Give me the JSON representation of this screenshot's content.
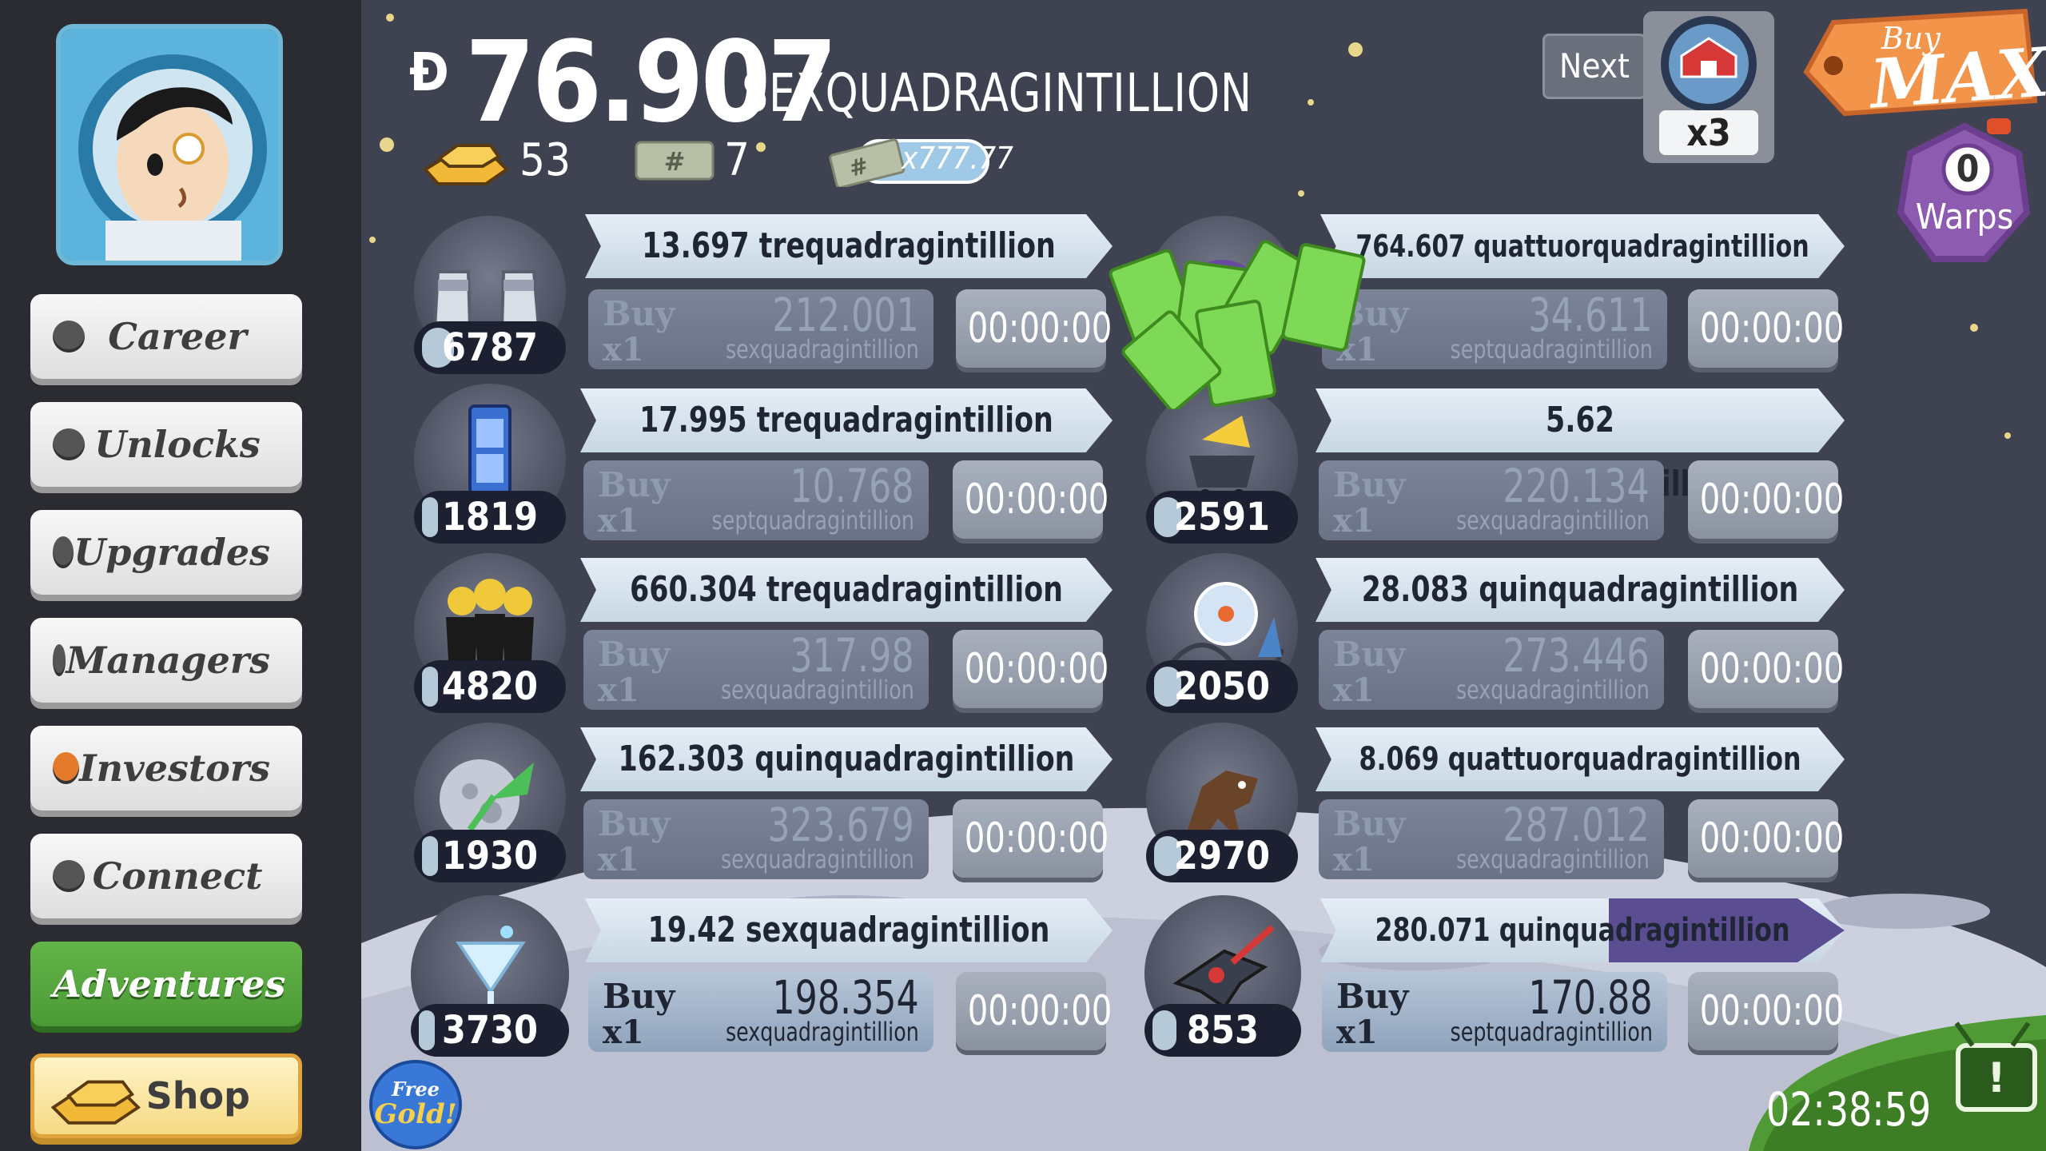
{
  "money": {
    "symbol": "Đ",
    "value": "76.907",
    "unit": "SEXQUADRAGINTILLION"
  },
  "stats": {
    "gold": "53",
    "megabucks": "7",
    "multiplier": "x777.77"
  },
  "nav": [
    {
      "label": "Career",
      "dot": "#555555"
    },
    {
      "label": "Unlocks",
      "dot": "#555555"
    },
    {
      "label": "Upgrades",
      "dot": "#555555"
    },
    {
      "label": "Managers",
      "dot": "#555555"
    },
    {
      "label": "Investors",
      "dot": "#e57a2a"
    },
    {
      "label": "Connect",
      "dot": "#555555"
    },
    {
      "label": "Adventures",
      "dot": "#555555"
    },
    {
      "label": "Shop"
    }
  ],
  "top_right": {
    "next_label": "Next",
    "next_multiplier": "x3",
    "buy_label": "Buy",
    "max_label": "MAX",
    "warps_count": "0",
    "warps_label": "Warps"
  },
  "free_gold": {
    "line1": "Free",
    "line2": "Gold!"
  },
  "timer": "02:38:59",
  "businesses_left": [
    {
      "count": "6787",
      "rate": "13.697 trequadragintillion /sec",
      "buy": "Buy",
      "qty": "x1",
      "cost": "212.001",
      "cost_unit": "sexquadragintillion",
      "timer": "00:00:00",
      "icon": "moon-boots-icon"
    },
    {
      "count": "1819",
      "rate": "17.995 trequadragintillion /sec",
      "buy": "Buy",
      "qty": "x1",
      "cost": "10.768",
      "cost_unit": "septquadragintillion",
      "timer": "00:00:00",
      "icon": "phone-booth-icon"
    },
    {
      "count": "4820",
      "rate": "660.304 trequadragintillion /sec",
      "buy": "Buy",
      "qty": "x1",
      "cost": "317.98",
      "cost_unit": "sexquadragintillion",
      "timer": "00:00:00",
      "icon": "clones-icon"
    },
    {
      "count": "1930",
      "rate": "162.303 quinquadragintillion /sec",
      "buy": "Buy",
      "qty": "x1",
      "cost": "323.679",
      "cost_unit": "sexquadragintillion",
      "timer": "00:00:00",
      "icon": "moon-rocket-icon"
    },
    {
      "count": "3730",
      "rate": "19.42 sexquadragintillion /sec",
      "buy": "Buy",
      "qty": "x1",
      "cost": "198.354",
      "cost_unit": "sexquadragintillion",
      "timer": "00:00:00",
      "icon": "cocktail-icon"
    }
  ],
  "businesses_right": [
    {
      "count": "",
      "rate": "764.607 quattuorquadragintillion /sec",
      "buy": "Buy",
      "qty": "x1",
      "cost": "34.611",
      "cost_unit": "septquadragintillion",
      "timer": "00:00:00",
      "icon": "moon-dome-icon"
    },
    {
      "count": "2591",
      "rate": "5.62 quattuorquadragintillion /sec",
      "buy": "Buy",
      "qty": "x1",
      "cost": "220.134",
      "cost_unit": "sexquadragintillion",
      "timer": "00:00:00",
      "icon": "cheese-mine-icon"
    },
    {
      "count": "2050",
      "rate": "28.083 quinquadragintillion /sec",
      "buy": "Buy",
      "qty": "x1",
      "cost": "273.446",
      "cost_unit": "sexquadragintillion",
      "timer": "00:00:00",
      "icon": "amusement-park-icon"
    },
    {
      "count": "2970",
      "rate": "8.069 quattuorquadragintillion /sec",
      "buy": "Buy",
      "qty": "x1",
      "cost": "287.012",
      "cost_unit": "sexquadragintillion",
      "timer": "00:00:00",
      "icon": "werewolf-icon"
    },
    {
      "count": "853",
      "rate": "280.071 quinquadragintillion /sec",
      "buy": "Buy",
      "qty": "x1",
      "cost": "170.88",
      "cost_unit": "septquadragintillion",
      "timer": "00:00:00",
      "icon": "ray-gun-icon",
      "progress": 0.55
    }
  ]
}
